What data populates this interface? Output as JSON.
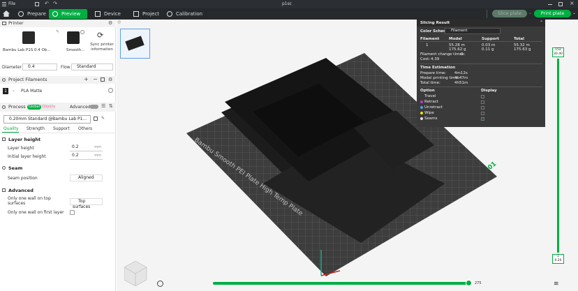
{
  "titlebar": {
    "menu": "File",
    "title": "p1sc"
  },
  "nav": {
    "tabs": [
      {
        "label": "Prepare"
      },
      {
        "label": "Preview"
      },
      {
        "label": "Device"
      },
      {
        "label": "Project"
      },
      {
        "label": "Calibration"
      }
    ],
    "slice_label": "Slice plate",
    "print_label": "Print plate"
  },
  "printer": {
    "header": "Printer",
    "printer_name": "Bambu Lab P1S 0.4 Ob...",
    "plate_name": "Smooth...",
    "sync_label": "Sync printer information",
    "diameter_label": "Diameter",
    "diameter_value": "0.4",
    "flow_label": "Flow",
    "flow_value": "Standard"
  },
  "filaments": {
    "header": "Project Filaments",
    "items": [
      {
        "index": "1",
        "name": "PLA Matte"
      }
    ]
  },
  "process": {
    "header": "Process",
    "toggle_global": "Global",
    "toggle_objects": "Objects",
    "advanced_label": "Advanced",
    "profile": "0.20mm Standard @Bambu Lab P1...",
    "tabs": [
      {
        "label": "Quality"
      },
      {
        "label": "Strength"
      },
      {
        "label": "Support"
      },
      {
        "label": "Others"
      }
    ]
  },
  "settings": {
    "layer_height_title": "Layer height",
    "layer_height_label": "Layer height",
    "layer_height_value": "0.2",
    "layer_height_unit": "mm",
    "initial_layer_label": "Initial layer height",
    "initial_layer_value": "0.2",
    "initial_layer_unit": "mm",
    "seam_title": "Seam",
    "seam_label": "Seam position",
    "seam_value": "Aligned",
    "advanced_title": "Advanced",
    "one_wall_top_label": "Only one wall on top surfaces",
    "one_wall_top_value": "Top surfaces",
    "one_wall_first_label": "Only one wall on first layer"
  },
  "result": {
    "title": "Slicing Result",
    "color_scheme_label": "Color Scheme",
    "color_scheme_value": "Filament",
    "cols": {
      "filament": "Filament",
      "model": "Model",
      "support": "Support",
      "total": "Total"
    },
    "row": {
      "filament": "1",
      "model_m": "55.28 m",
      "model_g": "175.62 g",
      "support_m": "0.03 m",
      "support_g": "0.11 g",
      "total_m": "55.32 m",
      "total_g": "175.63 g"
    },
    "filament_change": "Filament change times:",
    "filament_change_value": "0",
    "cost": "Cost:",
    "cost_value": "4.39",
    "time_title": "Time Estimation",
    "prepare_time_label": "Prepare time:",
    "prepare_time_value": "4m12s",
    "model_time_label": "Model printing time:",
    "model_time_value": "4h47m",
    "total_time_label": "Total time:",
    "total_time_value": "4h51m",
    "option_label": "Option",
    "display_label": "Display",
    "options": [
      {
        "name": "Travel",
        "color": "#3a3a3a"
      },
      {
        "name": "Retract",
        "color": "#cc33cc"
      },
      {
        "name": "Unretract",
        "color": "#4fa3e0"
      },
      {
        "name": "Wipe",
        "color": "#e6e600"
      },
      {
        "name": "Seams",
        "color": "#e0e0e0"
      }
    ]
  },
  "plate": {
    "label": "Bambu Smooth PEI Plate High Temp Plate",
    "number": "01"
  },
  "sliders": {
    "layer_top": "152",
    "layer_top_h": "30.40",
    "layer_bottom": "1",
    "layer_bottom_h": "0.20",
    "horizontal_value": "275"
  },
  "colors": {
    "accent": "#00ae42",
    "nav_bg": "#25292c",
    "title_bg": "#2b2f33"
  }
}
